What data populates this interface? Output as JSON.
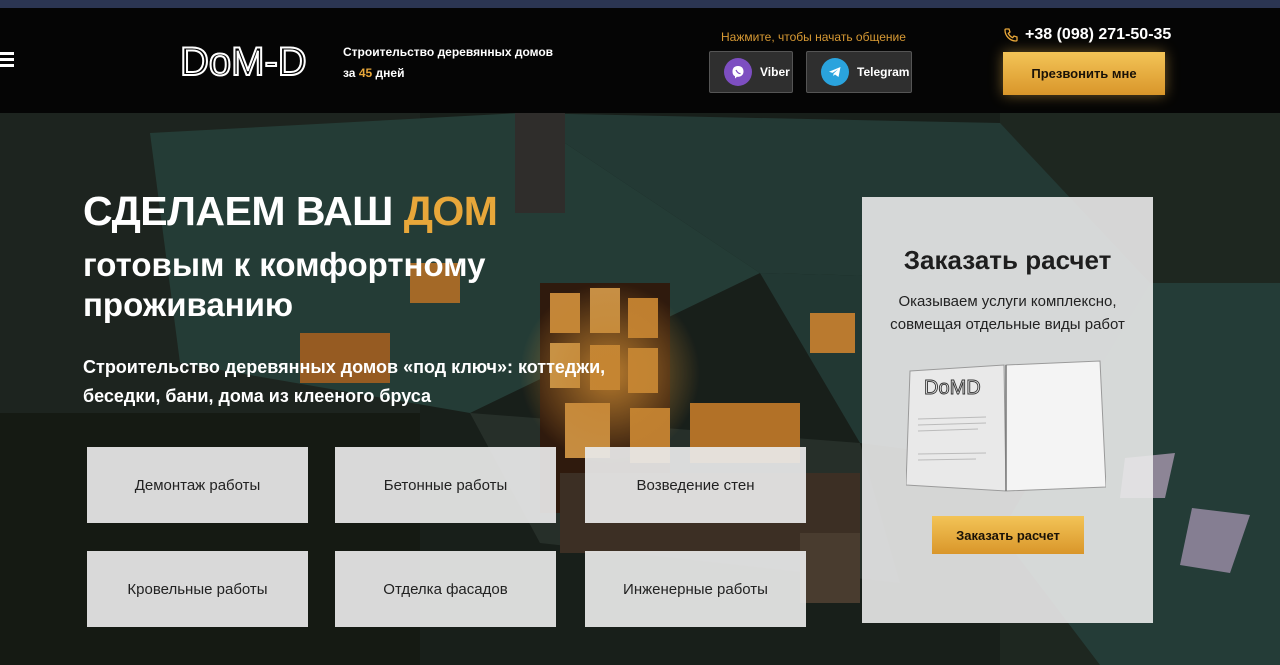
{
  "header": {
    "logo_text": "DoM-D",
    "tagline_line1": "Строительство деревянных домов",
    "tagline_prefix": "за",
    "tagline_days": "45",
    "tagline_suffix": "дней",
    "contact_prompt": "Нажмите, чтобы начать общение",
    "viber_label": "Viber",
    "telegram_label": "Telegram",
    "phone": "+38 (098) 271-50-35",
    "callback_label": "Презвонить мне"
  },
  "hero": {
    "headline_part1": "СДЕЛАЕМ ВАШ",
    "headline_accent": "ДОМ",
    "headline_line2": "готовым к комфортному проживанию",
    "subtitle": "Строительство деревянных домов «под ключ»: коттеджи, беседки, бани, дома из клееного бруса"
  },
  "services": [
    "Демонтаж работы",
    "Бетонные работы",
    "Возведение стен",
    "Кровельные работы",
    "Отделка фасадов",
    "Инженерные работы"
  ],
  "order": {
    "title": "Заказать расчет",
    "description": "Оказываем услуги комплексно, совмещая отдельные виды работ",
    "book_logo": "DoMD",
    "button_label": "Заказать расчет"
  },
  "colors": {
    "accent": "#e8a73a",
    "header_bg": "#050505",
    "button_gold": "#f3c457"
  },
  "icons": [
    "menu-icon",
    "viber-icon",
    "telegram-icon",
    "phone-icon"
  ]
}
